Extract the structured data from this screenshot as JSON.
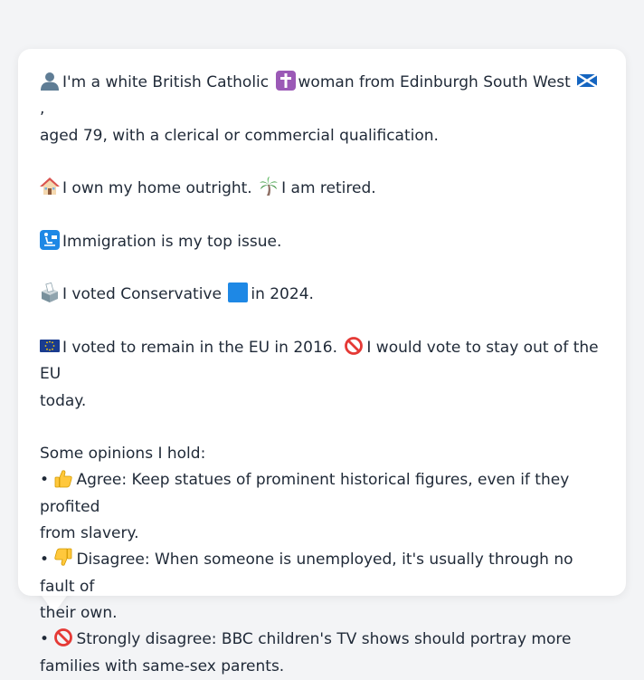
{
  "profile": {
    "identity": {
      "part1": "I'm a white British Catholic",
      "part2": "woman from Edinburgh South West",
      "part3": ",",
      "part4": "aged 79, with a clerical or commercial qualification."
    },
    "housing": {
      "part1": "I own my home outright.",
      "part2": "I am retired."
    },
    "issue": "Immigration is my top issue.",
    "vote": {
      "part1": "I voted Conservative",
      "part2": "in 2024."
    },
    "eu": {
      "part1": "I voted to remain in the EU in 2016.",
      "part2": "I would vote to stay out of the EU",
      "part3": "today."
    }
  },
  "opinions": {
    "heading": "Some opinions I hold:",
    "bullet": "•",
    "items": [
      {
        "icon": "thumbs-up-icon",
        "line1": "Agree: Keep statues of prominent historical figures, even if they profited",
        "line2": "from slavery."
      },
      {
        "icon": "thumbs-down-icon",
        "line1": "Disagree: When someone is unemployed, it's usually through no fault of",
        "line2": "their own."
      },
      {
        "icon": "prohibited-icon",
        "line1": "Strongly disagree: BBC children's TV shows should portray more",
        "line2": "families with same-sex parents."
      }
    ]
  },
  "colors": {
    "card_background": "#ffffff",
    "page_background": "#f3f4f6",
    "text": "#1f2937",
    "conservative_blue": "#1e88e5"
  }
}
